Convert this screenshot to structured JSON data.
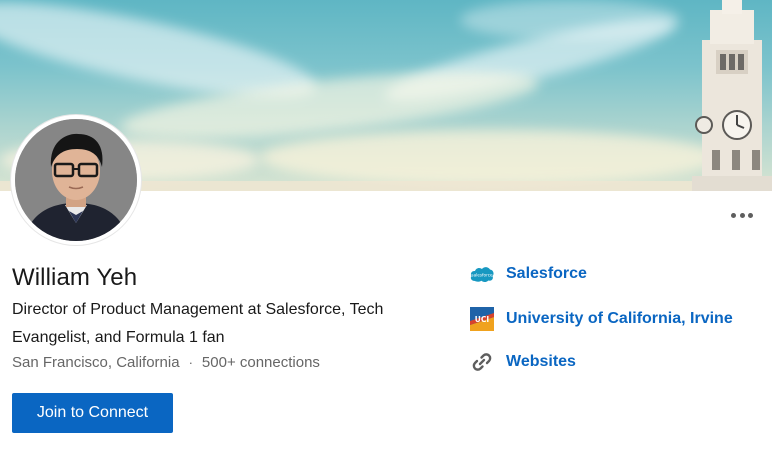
{
  "profile": {
    "name": "William Yeh",
    "headline": "Director of Product Management at Salesforce, Tech Evangelist, and Formula 1 fan",
    "location": "San Francisco, California",
    "separator": "·",
    "connections": "500+ connections"
  },
  "actions": {
    "join_label": "Join to Connect",
    "more_icon": "more-horizontal-icon"
  },
  "links": [
    {
      "label": "Salesforce",
      "icon": "salesforce-logo-icon",
      "icon_text": "salesforce"
    },
    {
      "label": "University of California, Irvine",
      "icon": "uci-logo-icon",
      "icon_text": "UCI"
    },
    {
      "label": "Websites",
      "icon": "link-chain-icon"
    }
  ],
  "colors": {
    "accent": "#0a66c2",
    "text": "#191919",
    "muted": "#666666"
  }
}
